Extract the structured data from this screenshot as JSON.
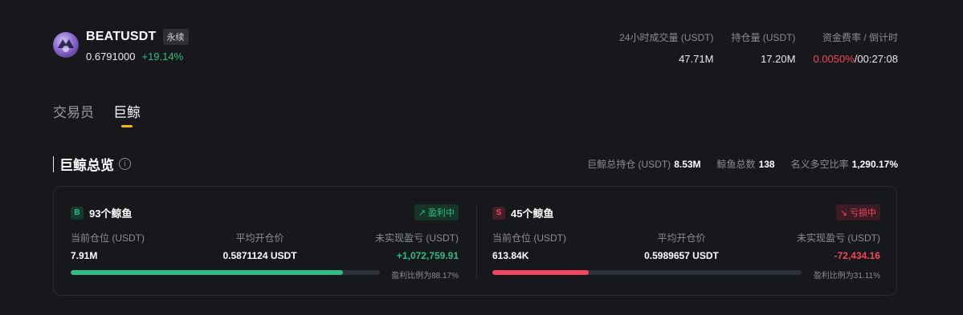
{
  "ticker": {
    "symbol": "BEATUSDT",
    "contract_tag": "永续",
    "price": "0.6791000",
    "change": "+19.14%"
  },
  "stats": [
    {
      "label": "24小时成交量 (USDT)",
      "value": "47.71M"
    },
    {
      "label": "持仓量 (USDT)",
      "value": "17.20M"
    },
    {
      "label": "资金费率 / 倒计时",
      "rate": "0.0050%",
      "separator": "/",
      "countdown": "00:27:08"
    }
  ],
  "tabs": [
    {
      "label": "交易员",
      "active": false
    },
    {
      "label": "巨鲸",
      "active": true
    }
  ],
  "overview": {
    "title": "巨鲸总览",
    "summary": [
      {
        "label": "巨鲸总持仓 (USDT)",
        "value": "8.53M"
      },
      {
        "label": "鲸鱼总数",
        "value": "138"
      },
      {
        "label": "名义多空比率",
        "value": "1,290.17%"
      }
    ]
  },
  "long_panel": {
    "badge": "B",
    "title": "93个鲸鱼",
    "pnl_tag": "盈利中",
    "cols": [
      {
        "label": "当前仓位 (USDT)",
        "value": "7.91M"
      },
      {
        "label": "平均开仓价",
        "value": "0.5871124 USDT"
      },
      {
        "label": "未实现盈亏 (USDT)",
        "value": "+1,072,759.91"
      }
    ],
    "profit_ratio_text": "盈利比例为88.17%",
    "profit_ratio": 0.8817
  },
  "short_panel": {
    "badge": "S",
    "title": "45个鲸鱼",
    "pnl_tag": "亏损中",
    "cols": [
      {
        "label": "当前仓位 (USDT)",
        "value": "613.84K"
      },
      {
        "label": "平均开仓价",
        "value": "0.5989657 USDT"
      },
      {
        "label": "未实现盈亏 (USDT)",
        "value": "-72,434.16"
      }
    ],
    "profit_ratio_text": "盈利比例为31.11%",
    "profit_ratio": 0.3111
  },
  "colors": {
    "up": "#2ebd85",
    "down": "#f6465d",
    "accent": "#f0b90b",
    "bg": "#17181c"
  }
}
